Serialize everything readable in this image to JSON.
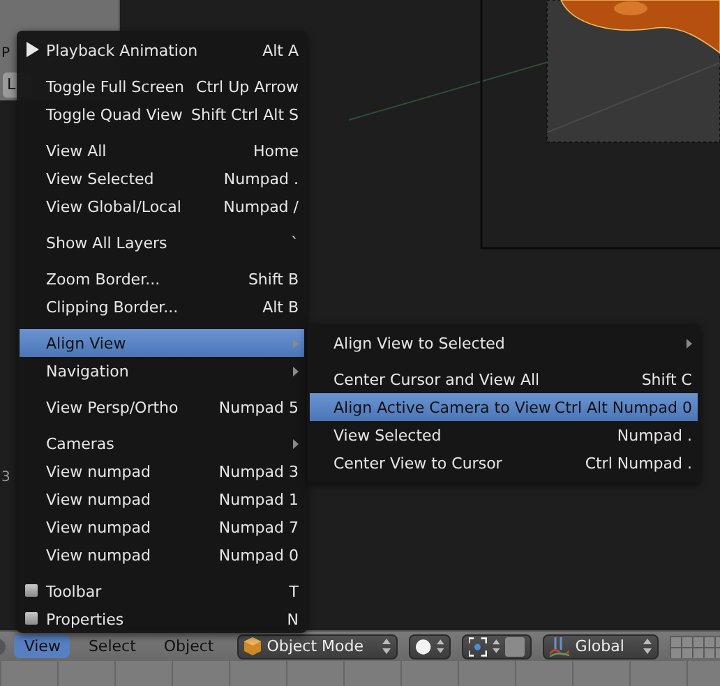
{
  "side_panel": {
    "fragments": [
      "P",
      "L"
    ]
  },
  "side_label": "3",
  "view_menu": {
    "sections": [
      [
        {
          "kind": "play",
          "label": "Playback Animation",
          "shortcut": "Alt A",
          "selected": false
        }
      ],
      [
        {
          "kind": "plain",
          "label": "Toggle Full Screen",
          "shortcut": "Ctrl Up Arrow",
          "selected": false
        },
        {
          "kind": "plain",
          "label": "Toggle Quad View",
          "shortcut": "Shift Ctrl Alt S",
          "selected": false
        }
      ],
      [
        {
          "kind": "plain",
          "label": "View All",
          "shortcut": "Home",
          "selected": false
        },
        {
          "kind": "plain",
          "label": "View Selected",
          "shortcut": "Numpad .",
          "selected": false
        },
        {
          "kind": "plain",
          "label": "View Global/Local",
          "shortcut": "Numpad /",
          "selected": false
        }
      ],
      [
        {
          "kind": "plain",
          "label": "Show All Layers",
          "shortcut": "`",
          "selected": false
        }
      ],
      [
        {
          "kind": "plain",
          "label": "Zoom Border...",
          "shortcut": "Shift B",
          "selected": false
        },
        {
          "kind": "plain",
          "label": "Clipping Border...",
          "shortcut": "Alt B",
          "selected": false
        }
      ],
      [
        {
          "kind": "submenu",
          "label": "Align View",
          "selected": true
        },
        {
          "kind": "submenu",
          "label": "Navigation",
          "selected": false
        }
      ],
      [
        {
          "kind": "plain",
          "label": "View Persp/Ortho",
          "shortcut": "Numpad 5",
          "selected": false
        }
      ],
      [
        {
          "kind": "submenu",
          "label": "Cameras",
          "selected": false
        },
        {
          "kind": "plain",
          "label": "View numpad",
          "shortcut": "Numpad 3",
          "selected": false
        },
        {
          "kind": "plain",
          "label": "View numpad",
          "shortcut": "Numpad 1",
          "selected": false
        },
        {
          "kind": "plain",
          "label": "View numpad",
          "shortcut": "Numpad 7",
          "selected": false
        },
        {
          "kind": "plain",
          "label": "View numpad",
          "shortcut": "Numpad 0",
          "selected": false
        }
      ],
      [
        {
          "kind": "checkbox",
          "label": "Toolbar",
          "shortcut": "T",
          "checked": false,
          "selected": false
        },
        {
          "kind": "checkbox",
          "label": "Properties",
          "shortcut": "N",
          "checked": false,
          "selected": false
        }
      ]
    ]
  },
  "align_submenu": {
    "sections": [
      [
        {
          "kind": "submenu",
          "label": "Align View to Selected",
          "selected": false
        }
      ],
      [
        {
          "kind": "plain",
          "label": "Center Cursor and View All",
          "shortcut": "Shift C",
          "selected": false
        },
        {
          "kind": "plain",
          "label": "Align Active Camera to View",
          "shortcut": "Ctrl Alt Numpad 0",
          "selected": true
        },
        {
          "kind": "plain",
          "label": "View Selected",
          "shortcut": "Numpad .",
          "selected": false
        },
        {
          "kind": "plain",
          "label": "Center View to Cursor",
          "shortcut": "Ctrl Numpad .",
          "selected": false
        }
      ]
    ]
  },
  "header": {
    "menus": [
      {
        "label": "View",
        "selected": true
      },
      {
        "label": "Select",
        "selected": false
      },
      {
        "label": "Object",
        "selected": false
      }
    ],
    "mode": "Object Mode",
    "orientation": "Global"
  }
}
